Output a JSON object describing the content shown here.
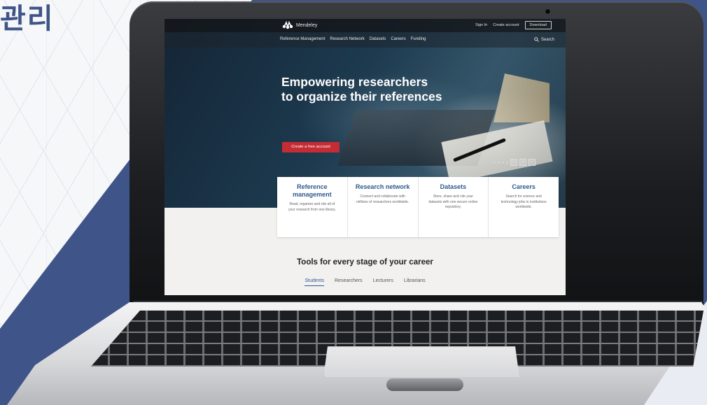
{
  "background": {
    "corner_glyph": "관리",
    "colors": {
      "band": "#3f5489",
      "grid": "#f6f7f9"
    }
  },
  "site": {
    "logo_text": "Mendeley",
    "top": {
      "sign_in": "Sign In",
      "create_account": "Create account",
      "download": "Download"
    },
    "nav": {
      "items": [
        {
          "label": "Reference Management"
        },
        {
          "label": "Research Network"
        },
        {
          "label": "Datasets"
        },
        {
          "label": "Careers"
        },
        {
          "label": "Funding"
        }
      ],
      "search_label": "Search"
    },
    "hero": {
      "title_line1": "Empowering researchers",
      "title_line2": "to organize their references",
      "cta_label": "Create a free account"
    },
    "cards": [
      {
        "title": "Reference management",
        "desc": "Read, organize and cite all of your research from one library."
      },
      {
        "title": "Research network",
        "desc": "Connect and collaborate with millions of researchers worldwide."
      },
      {
        "title": "Datasets",
        "desc": "Store, share and cite your datasets with one secure online repository."
      },
      {
        "title": "Careers",
        "desc": "Search for science and technology jobs in institutions worldwide."
      }
    ],
    "tools": {
      "title": "Tools for every stage of your career",
      "tabs": [
        {
          "label": "Students"
        },
        {
          "label": "Researchers"
        },
        {
          "label": "Lecturers"
        },
        {
          "label": "Librarians"
        }
      ]
    },
    "colors": {
      "accent": "#2f5a8e",
      "cta": "#c52c33"
    }
  }
}
